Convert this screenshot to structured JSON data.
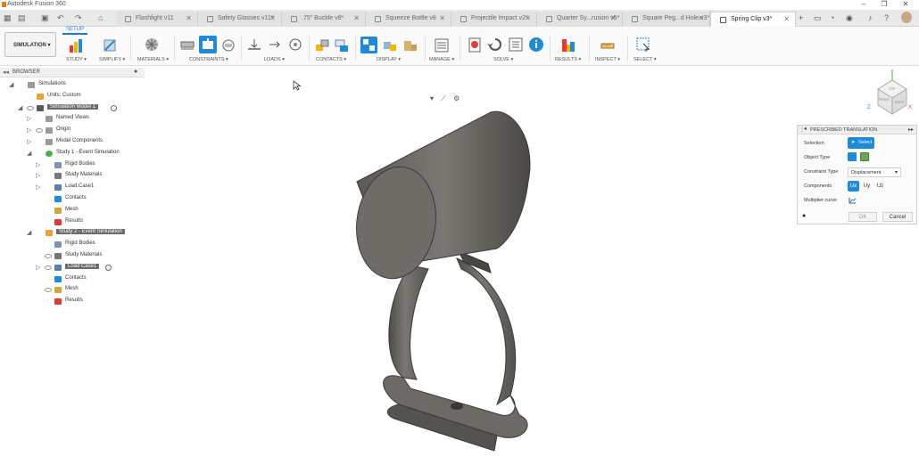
{
  "app": {
    "title": "Autodesk Fusion 360"
  },
  "window_controls": {
    "minimize": "–",
    "restore": "❐",
    "close": "✕"
  },
  "tabs": [
    {
      "label": "Flashlight v11",
      "active": false
    },
    {
      "label": "Safety Glasses v11*",
      "active": false
    },
    {
      "label": ".75\" Buckle v8*",
      "active": false
    },
    {
      "label": "Squeeze Bottle v8",
      "active": false
    },
    {
      "label": "Projectile Impact v2*",
      "active": false
    },
    {
      "label": "Quarter Sy...rusion v5*",
      "active": false
    },
    {
      "label": "Square Peg...d Hole v3*",
      "active": false
    },
    {
      "label": "Spring Clip v3*",
      "active": true
    }
  ],
  "ribbon": {
    "workspace": "SIMULATION ▾",
    "setup_tab": "SETUP",
    "groups": [
      {
        "label": "STUDY ▾"
      },
      {
        "label": "SIMPLIFY ▾"
      },
      {
        "label": "MATERIALS ▾"
      },
      {
        "label": "CONSTRAINTS ▾"
      },
      {
        "label": "LOADS ▾"
      },
      {
        "label": "CONTACTS ▾"
      },
      {
        "label": "DISPLAY ▾"
      },
      {
        "label": "MANAGE ▾"
      },
      {
        "label": "SOLVE ▾"
      },
      {
        "label": "RESULTS ▾"
      },
      {
        "label": "INSPECT ▾"
      },
      {
        "label": "SELECT ▾"
      }
    ]
  },
  "browser": {
    "header": "BROWSER",
    "nodes": [
      {
        "label": "Simulations",
        "indent": 0,
        "expander": "◢",
        "icon": "folder",
        "eye": false,
        "highlight": false
      },
      {
        "label": "Units: Custom",
        "indent": 1,
        "expander": "",
        "icon": "doc",
        "eye": false,
        "highlight": false
      },
      {
        "label": "Simulation Model 1",
        "indent": 1,
        "expander": "◢",
        "icon": "model",
        "eye": true,
        "highlight": true,
        "radio": true
      },
      {
        "label": "Named Views",
        "indent": 2,
        "expander": "▷",
        "icon": "folder",
        "eye": false,
        "highlight": false
      },
      {
        "label": "Origin",
        "indent": 2,
        "expander": "▷",
        "icon": "folder",
        "eye": true,
        "highlight": false
      },
      {
        "label": "Model Components",
        "indent": 2,
        "expander": "▷",
        "icon": "folder",
        "eye": false,
        "highlight": false
      },
      {
        "label": "Study 1 - Event Simulation",
        "indent": 2,
        "expander": "◢",
        "icon": "check",
        "eye": false,
        "highlight": false
      },
      {
        "label": "Rigid Bodies",
        "indent": 3,
        "expander": "▷",
        "icon": "rigid",
        "eye": false,
        "highlight": false
      },
      {
        "label": "Study Materials",
        "indent": 3,
        "expander": "▷",
        "icon": "material",
        "eye": false,
        "highlight": false
      },
      {
        "label": "Load Case1",
        "indent": 3,
        "expander": "▷",
        "icon": "load",
        "eye": false,
        "highlight": false
      },
      {
        "label": "Contacts",
        "indent": 3,
        "expander": "",
        "icon": "contact",
        "eye": false,
        "highlight": false
      },
      {
        "label": "Mesh",
        "indent": 3,
        "expander": "",
        "icon": "mesh",
        "eye": false,
        "highlight": false
      },
      {
        "label": "Results",
        "indent": 3,
        "expander": "",
        "icon": "result",
        "eye": false,
        "highlight": false
      },
      {
        "label": "Study 2 - Event Simulation",
        "indent": 2,
        "expander": "◢",
        "icon": "study",
        "eye": false,
        "highlight": true
      },
      {
        "label": "Rigid Bodies",
        "indent": 3,
        "expander": "",
        "icon": "rigid",
        "eye": false,
        "highlight": false
      },
      {
        "label": "Study Materials",
        "indent": 3,
        "expander": "",
        "icon": "material",
        "eye": true,
        "highlight": false
      },
      {
        "label": "Load Case1",
        "indent": 3,
        "expander": "▷",
        "icon": "load",
        "eye": true,
        "highlight": true,
        "radio": true
      },
      {
        "label": "Contacts",
        "indent": 3,
        "expander": "",
        "icon": "contact",
        "eye": false,
        "highlight": false
      },
      {
        "label": "Mesh",
        "indent": 3,
        "expander": "",
        "icon": "mesh",
        "eye": true,
        "highlight": false
      },
      {
        "label": "Results",
        "indent": 3,
        "expander": "",
        "icon": "result",
        "eye": false,
        "highlight": false
      }
    ]
  },
  "viewcube": {
    "axis_x": "X",
    "axis_y": "Y",
    "axis_z": "Z",
    "face_front": "FRONT",
    "face_right": "RIGHT",
    "face_top": "TOP"
  },
  "panel": {
    "title": "PRESCRIBED TRANSLATION",
    "selection_label": "Selection",
    "select_button": "Select",
    "object_type_label": "Object Type",
    "constraint_type_label": "Constraint Type",
    "constraint_type_value": "Displacement",
    "components_label": "Components",
    "components": [
      "Ux",
      "Uy",
      "Uz"
    ],
    "multiplier_label": "Multiplier curve",
    "ok": "OK",
    "cancel": "Cancel"
  },
  "colors": {
    "accent": "#1f8ad9",
    "model": "#6b6964"
  }
}
